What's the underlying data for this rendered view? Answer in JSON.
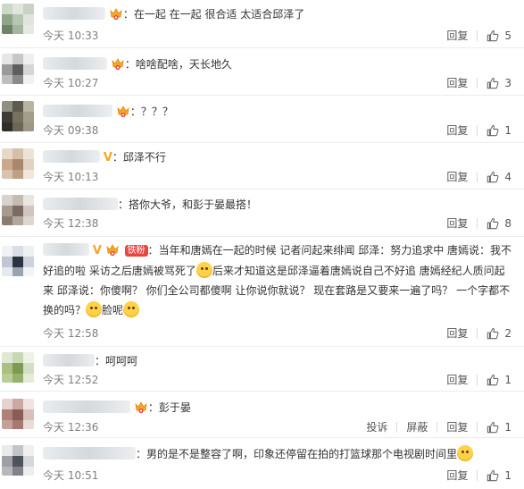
{
  "comments": [
    {
      "text": "在一起 在一起 很合适 太适合邱泽了",
      "time": "今天 10:33",
      "reply": "回复",
      "likes": "5"
    },
    {
      "text": "啥啥配啥，天长地久",
      "time": "今天 10:27",
      "reply": "回复",
      "likes": "3"
    },
    {
      "text": "？？？",
      "time": "今天 09:38",
      "reply": "回复",
      "likes": "1"
    },
    {
      "text": "邱泽不行",
      "time": "今天 10:13",
      "reply": "回复",
      "likes": "4"
    },
    {
      "text": "搭你大爷，和彭于晏最搭！",
      "time": "今天 12:38",
      "reply": "回复",
      "likes": "8"
    },
    {
      "tag": "铁粉",
      "line1": "当年和唐嫣在一起的时候 记者问起来绯闻 邱泽：努力追求中 唐嫣说：我不",
      "line2a": "好追的啦 采访之后唐嫣被骂死了",
      "line2b": "后来才知道这是邱泽逼着唐嫣说自己不好追 唐嫣经纪人质问起",
      "line3": "来 邱泽说：你傻啊？ 你们全公司都傻啊 让你说你就说？ 现在套路是又要来一遍了吗？ 一个字都不",
      "line4a": "换的吗？",
      "line4b": "脸呢",
      "time": "今天 12:58",
      "reply": "回复",
      "likes": "2"
    },
    {
      "text": "呵呵呵",
      "time": "今天 12:52",
      "reply": "回复",
      "likes": "1"
    },
    {
      "text": "彭于晏",
      "time": "今天 12:36",
      "report": "投诉",
      "block": "屏蔽",
      "reply": "回复",
      "likes": "1"
    },
    {
      "text": "男的是不是整容了啊，印象还停留在拍的打篮球那个电视剧时间里",
      "time": "今天 10:51",
      "reply": "回复",
      "likes": "1"
    }
  ],
  "colors": {
    "accent": "#f5a623",
    "tag_bg": "#e8473d",
    "emoji": "#ffd24a"
  }
}
